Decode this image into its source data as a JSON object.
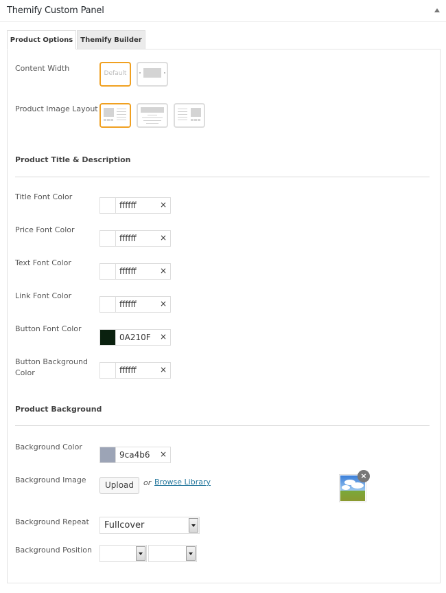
{
  "panel": {
    "title": "Themify Custom Panel",
    "collapse_icon": "triangle-up-icon"
  },
  "tabs": [
    {
      "label": "Product Options",
      "active": true
    },
    {
      "label": "Themify Builder",
      "active": false
    }
  ],
  "content_width": {
    "label": "Content Width",
    "options": [
      {
        "name": "default",
        "text": "Default",
        "selected": true
      },
      {
        "name": "fullwidth",
        "text": "",
        "selected": false
      }
    ]
  },
  "product_image_layout": {
    "label": "Product Image Layout",
    "options": [
      {
        "name": "image-left",
        "selected": true
      },
      {
        "name": "image-top",
        "selected": false
      },
      {
        "name": "image-right",
        "selected": false
      }
    ]
  },
  "section_title_desc": "Product Title & Description",
  "color_fields": [
    {
      "label": "Title Font Color",
      "value": "ffffff",
      "swatch": "#ffffff"
    },
    {
      "label": "Price Font Color",
      "value": "ffffff",
      "swatch": "#ffffff"
    },
    {
      "label": "Text Font Color",
      "value": "ffffff",
      "swatch": "#ffffff"
    },
    {
      "label": "Link Font Color",
      "value": "ffffff",
      "swatch": "#ffffff"
    },
    {
      "label": "Button Font Color",
      "value": "0A210F",
      "swatch": "#0a210f"
    },
    {
      "label": "Button Background Color",
      "label_line1": "Button Background",
      "label_line2": "Color",
      "value": "ffffff",
      "swatch": "#ffffff"
    }
  ],
  "clear_symbol": "×",
  "section_background": "Product Background",
  "background_color": {
    "label": "Background Color",
    "value": "9ca4b6",
    "swatch": "#9ca4b6"
  },
  "background_image": {
    "label": "Background Image",
    "upload_label": "Upload",
    "or_text": "or",
    "browse_label": "Browse Library",
    "remove_symbol": "×"
  },
  "background_repeat": {
    "label": "Background Repeat",
    "value": "Fullcover"
  },
  "background_position": {
    "label": "Background Position",
    "x_value": "",
    "y_value": ""
  },
  "colors": {
    "accent": "#f0a020",
    "link": "#21759b"
  }
}
